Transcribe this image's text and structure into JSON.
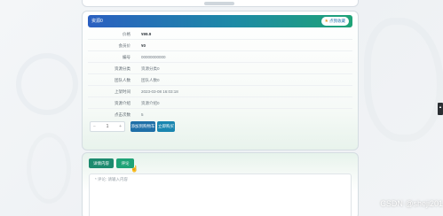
{
  "header": {
    "title": "资源0",
    "favorite_label": "点我收藏",
    "favorite_icon": "star-icon"
  },
  "details": [
    {
      "label": "价格",
      "value": "¥99.9"
    },
    {
      "label": "会员价",
      "value": "¥0"
    },
    {
      "label": "编号",
      "value": "00000000000"
    },
    {
      "label": "资源分类",
      "value": "资源分类0"
    },
    {
      "label": "团队人数",
      "value": "团队人数0"
    },
    {
      "label": "上架时间",
      "value": "2023-03-08 16:03:18"
    },
    {
      "label": "资源介绍",
      "value": "资源介绍0"
    },
    {
      "label": "点击次数",
      "value": "5"
    }
  ],
  "purchase": {
    "quantity": "1",
    "minus": "−",
    "plus": "+",
    "add_to_cart_label": "添加到购物车",
    "buy_now_label": "立即购买"
  },
  "tabs": [
    {
      "label": "详情内容"
    },
    {
      "label": "评论"
    }
  ],
  "comment": {
    "placeholder": "* 评论: 请输入内容"
  },
  "watermark": "CSDN @sheji201",
  "colors": {
    "header_gradient_start": "#2a5fc1",
    "header_gradient_end": "#1fa377",
    "cart_button": "#1f6fa8",
    "tab_active": "#1d8a6e"
  }
}
